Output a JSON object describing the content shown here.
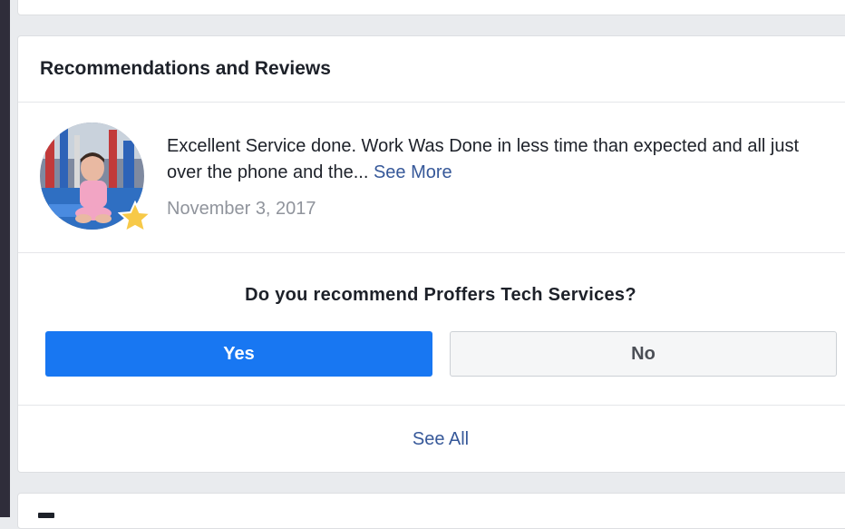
{
  "section": {
    "title": "Recommendations and Reviews"
  },
  "review": {
    "text": "Excellent Service done. Work Was Done in less time than expected and all just over the phone and the...",
    "see_more_label": "See More",
    "date": "November 3, 2017",
    "avatar_icon": "user-avatar-photo",
    "badge_icon": "star-icon"
  },
  "recommend": {
    "question": "Do you recommend Proffers Tech Services?",
    "yes_label": "Yes",
    "no_label": "No"
  },
  "footer": {
    "see_all_label": "See All"
  },
  "colors": {
    "accent": "#1877f2",
    "link": "#365899",
    "star": "#f7c948"
  }
}
